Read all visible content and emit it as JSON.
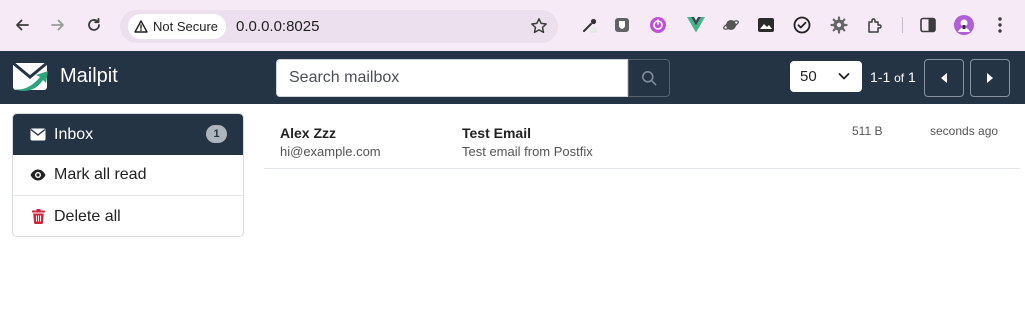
{
  "browser": {
    "security_label": "Not Secure",
    "url": "0.0.0.0:8025"
  },
  "app": {
    "brand": "Mailpit",
    "search_placeholder": "Search mailbox",
    "per_page": "50",
    "paging_range": "1-1",
    "paging_of": "of",
    "paging_total": "1"
  },
  "sidebar": {
    "items": [
      {
        "label": "Inbox",
        "icon": "envelope-icon",
        "badge": "1"
      },
      {
        "label": "Mark all read",
        "icon": "eye-icon"
      },
      {
        "label": "Delete all",
        "icon": "trash-icon"
      }
    ]
  },
  "messages": [
    {
      "from_name": "Alex Zzz",
      "from_email": "hi@example.com",
      "subject": "Test Email",
      "snippet": "Test email from Postfix",
      "size": "511 B",
      "time": "seconds ago"
    }
  ],
  "colors": {
    "chrome_bg": "#f6eaf6",
    "header_bg": "#253445",
    "brand_green": "#2fa37a",
    "delete_red": "#d0263b"
  }
}
